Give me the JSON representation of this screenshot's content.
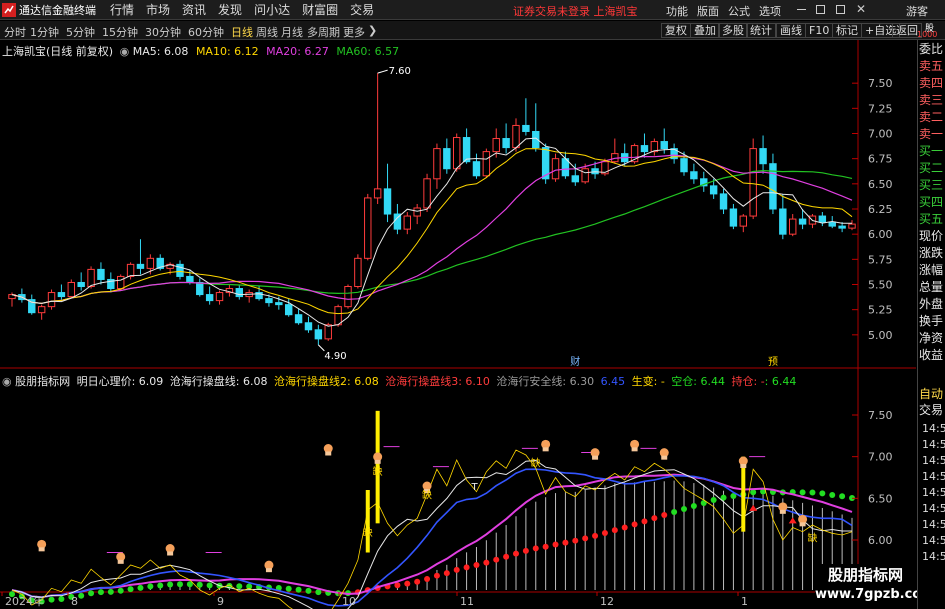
{
  "app": {
    "title": "通达信金融终端",
    "status": "证券交易未登录 上海凯宝"
  },
  "menu": [
    "行情",
    "市场",
    "资讯",
    "发现",
    "问小达",
    "财富圈",
    "交易"
  ],
  "menu_right": [
    "功能",
    "版面",
    "公式",
    "选项"
  ],
  "guest": "游客",
  "periods": [
    "分时",
    "1分钟",
    "5分钟",
    "15分钟",
    "30分钟",
    "60分钟",
    "日线",
    "周线",
    "月线",
    "多周期",
    "更多"
  ],
  "active_period": "日线",
  "toolbar_right": [
    "复权",
    "叠加",
    "多股",
    "统计",
    "画线",
    "F10",
    "标记",
    "+自选",
    "返回"
  ],
  "side_tabs": [
    {
      "label": "委比",
      "kind": "plain"
    },
    {
      "label": "卖五",
      "kind": "sell"
    },
    {
      "label": "卖四",
      "kind": "sell"
    },
    {
      "label": "卖三",
      "kind": "sell"
    },
    {
      "label": "卖二",
      "kind": "sell"
    },
    {
      "label": "卖一",
      "kind": "sell"
    },
    {
      "label": "买一",
      "kind": "buy"
    },
    {
      "label": "买二",
      "kind": "buy"
    },
    {
      "label": "买三",
      "kind": "buy"
    },
    {
      "label": "买四",
      "kind": "buy"
    },
    {
      "label": "买五",
      "kind": "buy"
    },
    {
      "label": "现价",
      "kind": "plain"
    },
    {
      "label": "涨跌",
      "kind": "plain"
    },
    {
      "label": "涨幅",
      "kind": "plain"
    },
    {
      "label": "总量",
      "kind": "plain"
    },
    {
      "label": "外盘",
      "kind": "plain"
    },
    {
      "label": "换手",
      "kind": "plain"
    },
    {
      "label": "净资",
      "kind": "plain"
    },
    {
      "label": "收益",
      "kind": "plain"
    }
  ],
  "side_extra": {
    "auto": "自动",
    "trade": "交易",
    "times": [
      "14:56",
      "14:56",
      "14:56",
      "14:56",
      "14:56",
      "14:56",
      "14:56",
      "14:56",
      "14:56"
    ]
  },
  "top_corner": {
    "unit": "股",
    "value": "1000"
  },
  "colors": {
    "up": "#ff3c3c",
    "down": "#33d9f5",
    "ma5": "#e8e8e8",
    "ma10": "#ffd700",
    "ma20": "#e03fe0",
    "ma60": "#22c222",
    "axis": "#c00000"
  },
  "chart_data": [
    {
      "type": "candlestick",
      "title": "上海凯宝(日线 前复权)",
      "ma_labels": [
        {
          "name": "MA5",
          "value": "6.08",
          "color": "#e8e8e8"
        },
        {
          "name": "MA10",
          "value": "6.12",
          "color": "#ffd700"
        },
        {
          "name": "MA20",
          "value": "6.27",
          "color": "#e03fe0"
        },
        {
          "name": "MA60",
          "value": "6.57",
          "color": "#22c222"
        }
      ],
      "ylim": [
        4.75,
        7.75
      ],
      "yticks": [
        5.0,
        5.25,
        5.5,
        5.75,
        6.0,
        6.25,
        6.5,
        6.75,
        7.0,
        7.25,
        7.5
      ],
      "tick_labels": [
        "5.00",
        "5.25",
        "5.50",
        "5.75",
        "6.00",
        "6.25",
        "6.50",
        "6.75",
        "7.00",
        "7.25",
        "7.50"
      ],
      "annotations": [
        {
          "text": "7.60",
          "value": 7.6
        },
        {
          "text": "4.90",
          "value": 4.9
        }
      ],
      "event_markers": [
        "财",
        "预"
      ],
      "ohlc": [
        [
          5.36,
          5.42,
          5.28,
          5.4
        ],
        [
          5.4,
          5.46,
          5.32,
          5.35
        ],
        [
          5.35,
          5.4,
          5.2,
          5.22
        ],
        [
          5.22,
          5.3,
          5.15,
          5.28
        ],
        [
          5.28,
          5.45,
          5.25,
          5.42
        ],
        [
          5.42,
          5.5,
          5.35,
          5.38
        ],
        [
          5.38,
          5.55,
          5.36,
          5.52
        ],
        [
          5.52,
          5.62,
          5.44,
          5.48
        ],
        [
          5.48,
          5.68,
          5.46,
          5.65
        ],
        [
          5.65,
          5.72,
          5.5,
          5.55
        ],
        [
          5.55,
          5.62,
          5.42,
          5.46
        ],
        [
          5.46,
          5.6,
          5.44,
          5.58
        ],
        [
          5.58,
          5.72,
          5.55,
          5.7
        ],
        [
          5.7,
          5.95,
          5.6,
          5.66
        ],
        [
          5.66,
          5.8,
          5.6,
          5.76
        ],
        [
          5.76,
          5.8,
          5.64,
          5.66
        ],
        [
          5.66,
          5.72,
          5.6,
          5.7
        ],
        [
          5.7,
          5.74,
          5.55,
          5.58
        ],
        [
          5.58,
          5.65,
          5.5,
          5.52
        ],
        [
          5.52,
          5.56,
          5.38,
          5.4
        ],
        [
          5.4,
          5.48,
          5.3,
          5.34
        ],
        [
          5.34,
          5.44,
          5.3,
          5.42
        ],
        [
          5.42,
          5.5,
          5.38,
          5.46
        ],
        [
          5.46,
          5.5,
          5.35,
          5.38
        ],
        [
          5.38,
          5.45,
          5.32,
          5.42
        ],
        [
          5.42,
          5.48,
          5.34,
          5.36
        ],
        [
          5.36,
          5.4,
          5.28,
          5.32
        ],
        [
          5.32,
          5.38,
          5.25,
          5.3
        ],
        [
          5.3,
          5.36,
          5.18,
          5.2
        ],
        [
          5.2,
          5.26,
          5.1,
          5.12
        ],
        [
          5.12,
          5.18,
          5.02,
          5.05
        ],
        [
          5.05,
          5.1,
          4.9,
          4.96
        ],
        [
          4.96,
          5.12,
          4.94,
          5.1
        ],
        [
          5.1,
          5.3,
          5.08,
          5.28
        ],
        [
          5.28,
          5.5,
          5.26,
          5.48
        ],
        [
          5.48,
          5.8,
          5.46,
          5.76
        ],
        [
          5.76,
          6.4,
          5.74,
          6.36
        ],
        [
          6.36,
          7.6,
          6.3,
          6.45
        ],
        [
          6.45,
          6.7,
          6.12,
          6.2
        ],
        [
          6.2,
          6.3,
          6.0,
          6.05
        ],
        [
          6.05,
          6.22,
          6.0,
          6.18
        ],
        [
          6.18,
          6.3,
          6.1,
          6.26
        ],
        [
          6.26,
          6.6,
          6.22,
          6.55
        ],
        [
          6.55,
          6.9,
          6.45,
          6.85
        ],
        [
          6.85,
          6.95,
          6.6,
          6.65
        ],
        [
          6.65,
          7.0,
          6.62,
          6.96
        ],
        [
          6.96,
          7.05,
          6.7,
          6.72
        ],
        [
          6.72,
          6.8,
          6.55,
          6.58
        ],
        [
          6.58,
          6.85,
          6.56,
          6.82
        ],
        [
          6.82,
          7.05,
          6.76,
          6.95
        ],
        [
          6.95,
          7.1,
          6.8,
          6.86
        ],
        [
          6.86,
          7.15,
          6.82,
          7.08
        ],
        [
          7.08,
          7.35,
          6.98,
          7.02
        ],
        [
          7.02,
          7.3,
          6.82,
          6.86
        ],
        [
          6.86,
          6.9,
          6.5,
          6.55
        ],
        [
          6.55,
          6.8,
          6.52,
          6.75
        ],
        [
          6.75,
          6.82,
          6.55,
          6.58
        ],
        [
          6.58,
          6.7,
          6.48,
          6.52
        ],
        [
          6.52,
          6.7,
          6.5,
          6.65
        ],
        [
          6.65,
          6.72,
          6.55,
          6.6
        ],
        [
          6.6,
          6.75,
          6.58,
          6.72
        ],
        [
          6.72,
          6.95,
          6.7,
          6.8
        ],
        [
          6.8,
          6.9,
          6.68,
          6.72
        ],
        [
          6.72,
          6.9,
          6.7,
          6.88
        ],
        [
          6.88,
          7.0,
          6.76,
          6.82
        ],
        [
          6.82,
          6.95,
          6.78,
          6.92
        ],
        [
          6.92,
          7.05,
          6.8,
          6.85
        ],
        [
          6.85,
          6.9,
          6.7,
          6.75
        ],
        [
          6.75,
          6.82,
          6.58,
          6.62
        ],
        [
          6.62,
          6.7,
          6.5,
          6.55
        ],
        [
          6.55,
          6.62,
          6.42,
          6.48
        ],
        [
          6.48,
          6.55,
          6.35,
          6.4
        ],
        [
          6.4,
          6.45,
          6.2,
          6.25
        ],
        [
          6.25,
          6.3,
          6.05,
          6.08
        ],
        [
          6.08,
          6.2,
          6.02,
          6.18
        ],
        [
          6.18,
          6.95,
          6.15,
          6.85
        ],
        [
          6.85,
          6.98,
          6.6,
          6.7
        ],
        [
          6.7,
          6.8,
          6.2,
          6.25
        ],
        [
          6.25,
          6.4,
          5.95,
          6.0
        ],
        [
          6.0,
          6.2,
          5.98,
          6.15
        ],
        [
          6.15,
          6.25,
          6.05,
          6.1
        ],
        [
          6.1,
          6.2,
          6.06,
          6.18
        ],
        [
          6.18,
          6.22,
          6.08,
          6.12
        ],
        [
          6.12,
          6.18,
          6.06,
          6.08
        ],
        [
          6.08,
          6.12,
          6.02,
          6.06
        ],
        [
          6.06,
          6.14,
          6.04,
          6.1
        ]
      ]
    },
    {
      "type": "line",
      "title": "股朋指标网",
      "indicators": [
        {
          "label": "明日心理价: 6.09",
          "color": "#e8e8e8"
        },
        {
          "label": "沧海行操盘线: 6.08",
          "color": "#e8e8e8"
        },
        {
          "label": "沧海行操盘线2: 6.08",
          "color": "#ffd700"
        },
        {
          "label": "沧海行操盘线3: 6.10",
          "color": "#ff3c3c"
        },
        {
          "label": "沧海行安全线: 6.30",
          "color": "#9a9a9a"
        },
        {
          "label": "6.45",
          "color": "#3355ff"
        },
        {
          "label": "生变: -",
          "color": "#ffd700"
        },
        {
          "label": "空仓: 6.44",
          "color": "#22dd22"
        },
        {
          "label": "持仓: -",
          "color": "#ff3c3c"
        },
        {
          "label": ": 6.44",
          "color": "#22dd22"
        }
      ],
      "ylim": [
        5.4,
        7.8
      ],
      "yticks": [
        5.5,
        6.0,
        6.5,
        7.0,
        7.5
      ],
      "tick_labels": [
        "5.50",
        "6.00",
        "6.50",
        "7.00",
        "7.50"
      ],
      "signal_labels": [
        "缺",
        "缺",
        "缺",
        "缺",
        "缺",
        "T"
      ]
    }
  ],
  "x_axis": {
    "labels": [
      "2024年",
      "8",
      "9",
      "10",
      "11",
      "12",
      "1"
    ]
  },
  "watermark": {
    "title": "股朋指标网",
    "url": "www.7gpzb.com"
  }
}
